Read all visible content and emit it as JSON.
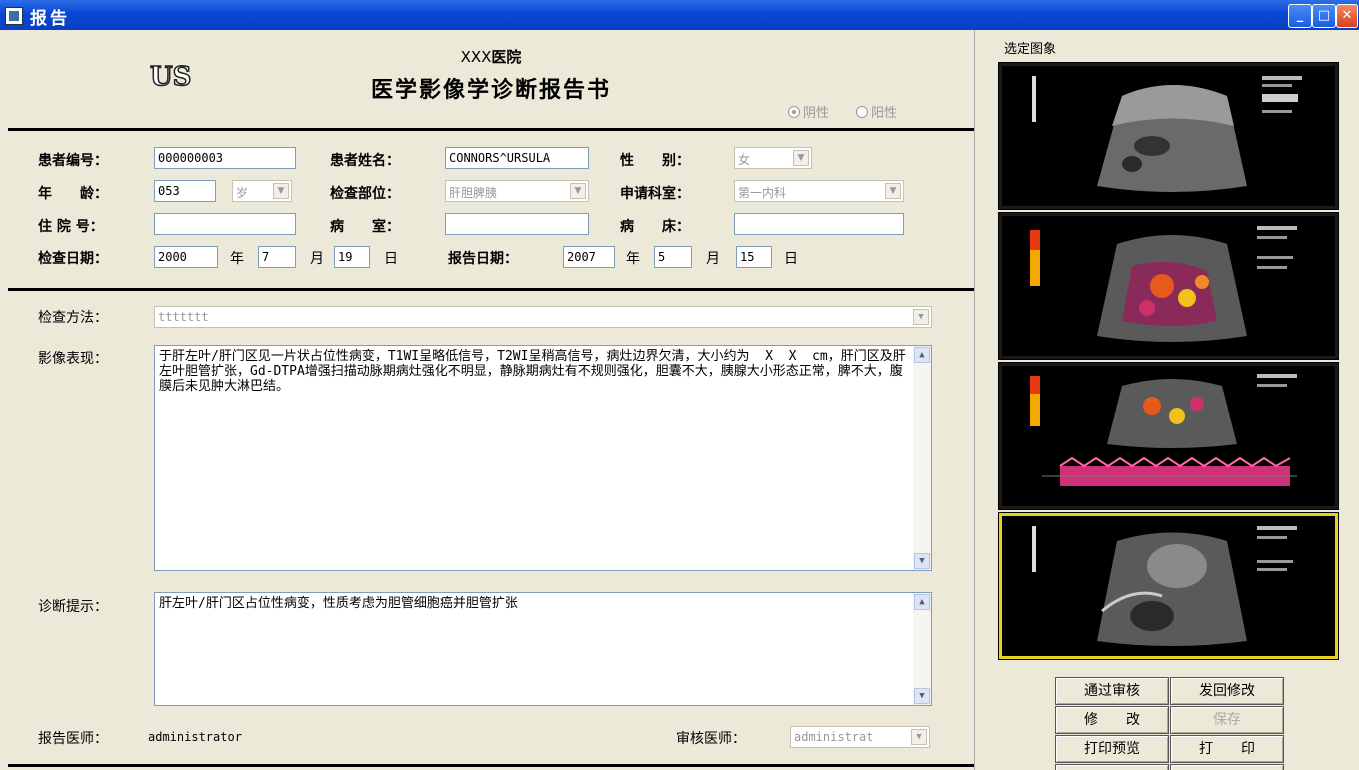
{
  "window": {
    "title": "报告"
  },
  "header": {
    "logo": "US",
    "hospital_prefix": "XXX",
    "hospital_suffix": "医院",
    "title": "医学影像学诊断报告书",
    "radio_negative": "阴性",
    "radio_positive": "阳性"
  },
  "patient": {
    "id_label": "患者编号：",
    "id_value": "000000003",
    "name_label": "患者姓名：",
    "name_value": "CONNORS^URSULA",
    "sex_label": "性　　别：",
    "sex_value": "女",
    "age_label": "年　　龄：",
    "age_value": "053",
    "age_unit": "岁",
    "part_label": "检查部位：",
    "part_value": "肝胆脾胰",
    "dept_label": "申请科室：",
    "dept_value": "第一内科",
    "inpatient_label": "住 院 号：",
    "inpatient_value": "",
    "ward_label": "病　　室：",
    "ward_value": "",
    "bed_label": "病　　床：",
    "bed_value": "",
    "exam_date_label": "检查日期：",
    "exam_year": "2000",
    "exam_month": "7",
    "exam_day": "19",
    "report_date_label": "报告日期：",
    "report_year": "2007",
    "report_month": "5",
    "report_day": "15",
    "year_unit": "年",
    "month_unit": "月",
    "day_unit": "日"
  },
  "report": {
    "method_label": "检查方法：",
    "method_value": "ttttttt",
    "findings_label": "影像表现：",
    "findings_value": "于肝左叶/肝门区见一片状占位性病变，T1WI呈略低信号，T2WI呈稍高信号，病灶边界欠清，大小约为  X  X  cm，肝门区及肝左叶胆管扩张，Gd-DTPA增强扫描动脉期病灶强化不明显，静脉期病灶有不规则强化，胆囊不大，胰腺大小形态正常，脾不大，腹膜后未见肿大淋巴结。",
    "diagnosis_label": "诊断提示：",
    "diagnosis_value": "肝左叶/肝门区占位性病变，性质考虑为胆管细胞癌并胆管扩张",
    "doctor_label": "报告医师：",
    "doctor_value": "administrator",
    "reviewer_label": "审核医师：",
    "reviewer_value": "administrat"
  },
  "side": {
    "title": "选定图象",
    "buttons": {
      "approve": "通过审核",
      "return": "发回修改",
      "modify": "修　　改",
      "save": "保存",
      "preview": "打印预览",
      "print": "打　　印"
    }
  }
}
